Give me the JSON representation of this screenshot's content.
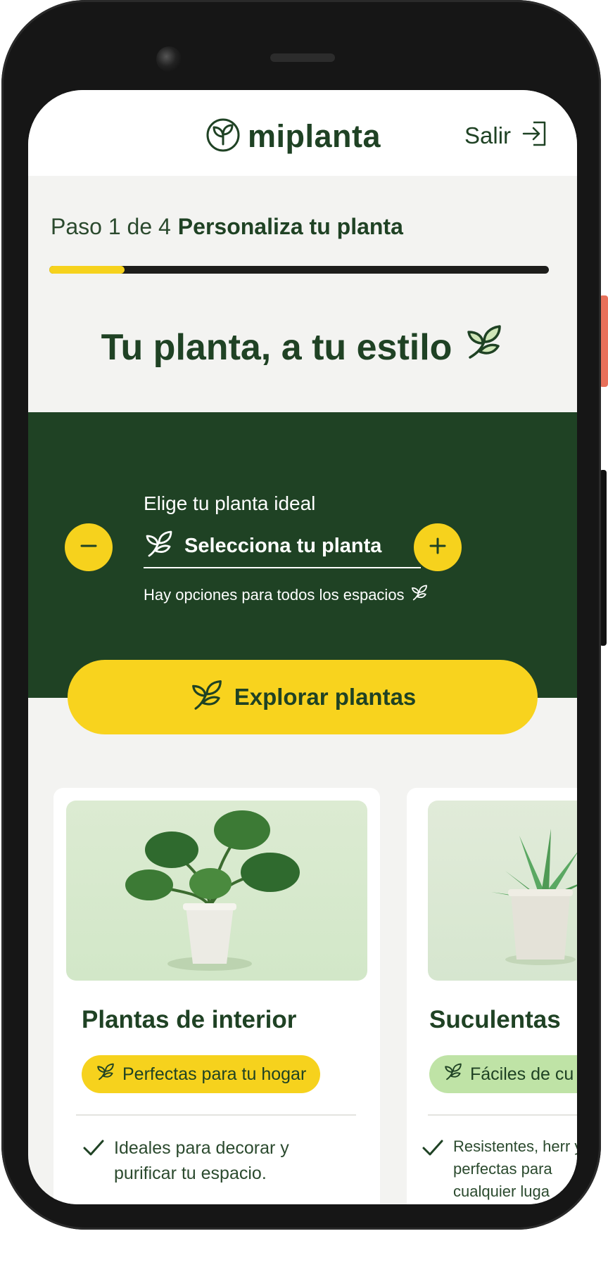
{
  "header": {
    "logo_text": "miplanta",
    "logout_label": "Salir"
  },
  "progress": {
    "step_text": "Paso 1 de 4",
    "step_title": "Personaliza tu planta",
    "fraction": 0.15
  },
  "hero": {
    "title": "Tu planta, a tu estilo"
  },
  "picker": {
    "label": "Elige tu planta ideal",
    "value": "Selecciona tu planta",
    "hint": "Hay opciones para todos los espacios"
  },
  "cta": {
    "label": "Explorar plantas"
  },
  "cards": [
    {
      "title": "Plantas de interior",
      "badge": "Perfectas para tu hogar",
      "feature": "Ideales para decorar y purificar tu espacio."
    },
    {
      "title": "Suculentas",
      "badge": "Fáciles de cu",
      "feature": "Resistentes, herr y perfectas para cualquier luga"
    }
  ],
  "colors": {
    "brand_green": "#1f4224",
    "accent_yellow": "#f6d21d",
    "badge_light_green": "#bfe3a6",
    "background": "#f3f3f1"
  },
  "icons": {
    "logo": "leaf-circle-icon",
    "logout": "logout-arrow-icon",
    "title": "leaf-icon",
    "minus": "minus-icon",
    "plus": "plus-icon",
    "check": "check-icon"
  }
}
